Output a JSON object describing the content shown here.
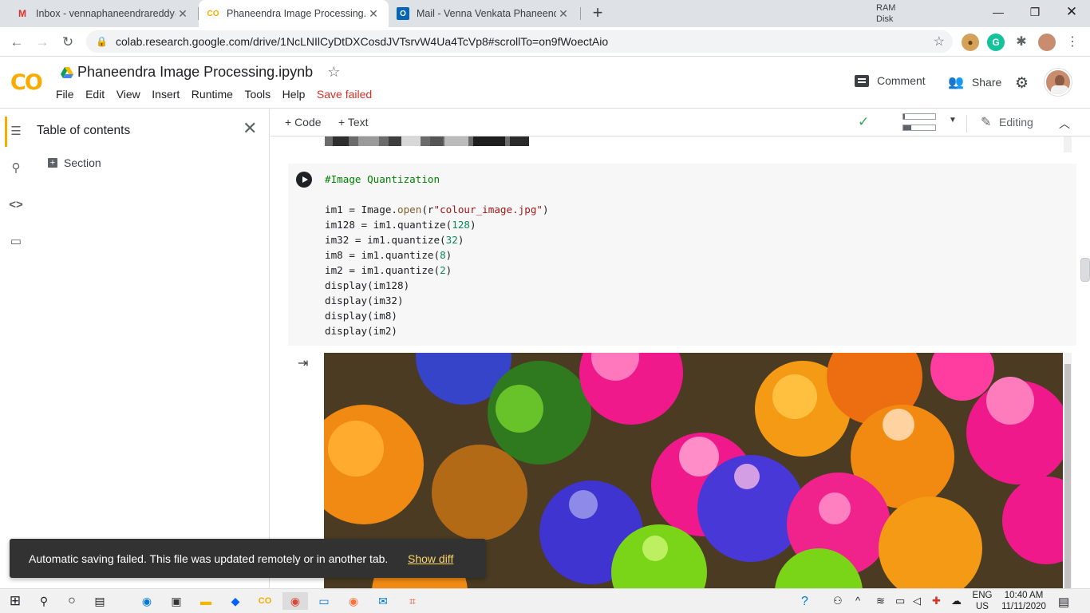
{
  "browser": {
    "tabs": [
      {
        "title": "Inbox - vennaphaneendrareddy@",
        "icon": "gmail-icon",
        "active": false
      },
      {
        "title": "Phaneendra Image Processing.ip",
        "icon": "colab-icon",
        "active": true
      },
      {
        "title": "Mail - Venna Venkata Phaneendr",
        "icon": "outlook-icon",
        "active": false
      }
    ],
    "url": "colab.research.google.com/drive/1NcLNIlCyDtDXCosdJVTsrvW4Ua4TcVp8#scrollTo=on9fWoectAio"
  },
  "colab": {
    "logo": "CO",
    "notebook_title": "Phaneendra Image Processing.ipynb",
    "menu": [
      "File",
      "Edit",
      "View",
      "Insert",
      "Runtime",
      "Tools",
      "Help"
    ],
    "save_status": "Save failed",
    "comment_label": "Comment",
    "share_label": "Share",
    "toolbar": {
      "code_label": "+ Code",
      "text_label": "+ Text",
      "ram_label": "RAM",
      "disk_label": "Disk",
      "ram_fraction": 0.05,
      "disk_fraction": 0.25,
      "editing_label": "Editing"
    },
    "sidebar": {
      "title": "Table of contents",
      "items": [
        "Section"
      ]
    },
    "cell": {
      "comment": "#Image Quantization",
      "lines": [
        "im1 = Image.open(r\"colour_image.jpg\")",
        "im128 = im1.quantize(128)",
        "im32 = im1.quantize(32)",
        "im8 = im1.quantize(8)",
        "im2 = im1.quantize(2)",
        "display(im128)",
        "display(im32)",
        "display(im8)",
        "display(im2)"
      ]
    }
  },
  "toast": {
    "message": "Automatic saving failed. This file was updated remotely or in another tab.",
    "action": "Show diff"
  },
  "taskbar": {
    "lang_top": "ENG",
    "lang_bottom": "US",
    "time": "10:40 AM",
    "date": "11/11/2020"
  },
  "colors": {
    "colab_orange": "#f9ab00",
    "save_failed": "#d93025",
    "link_yellow": "#fdd663"
  }
}
